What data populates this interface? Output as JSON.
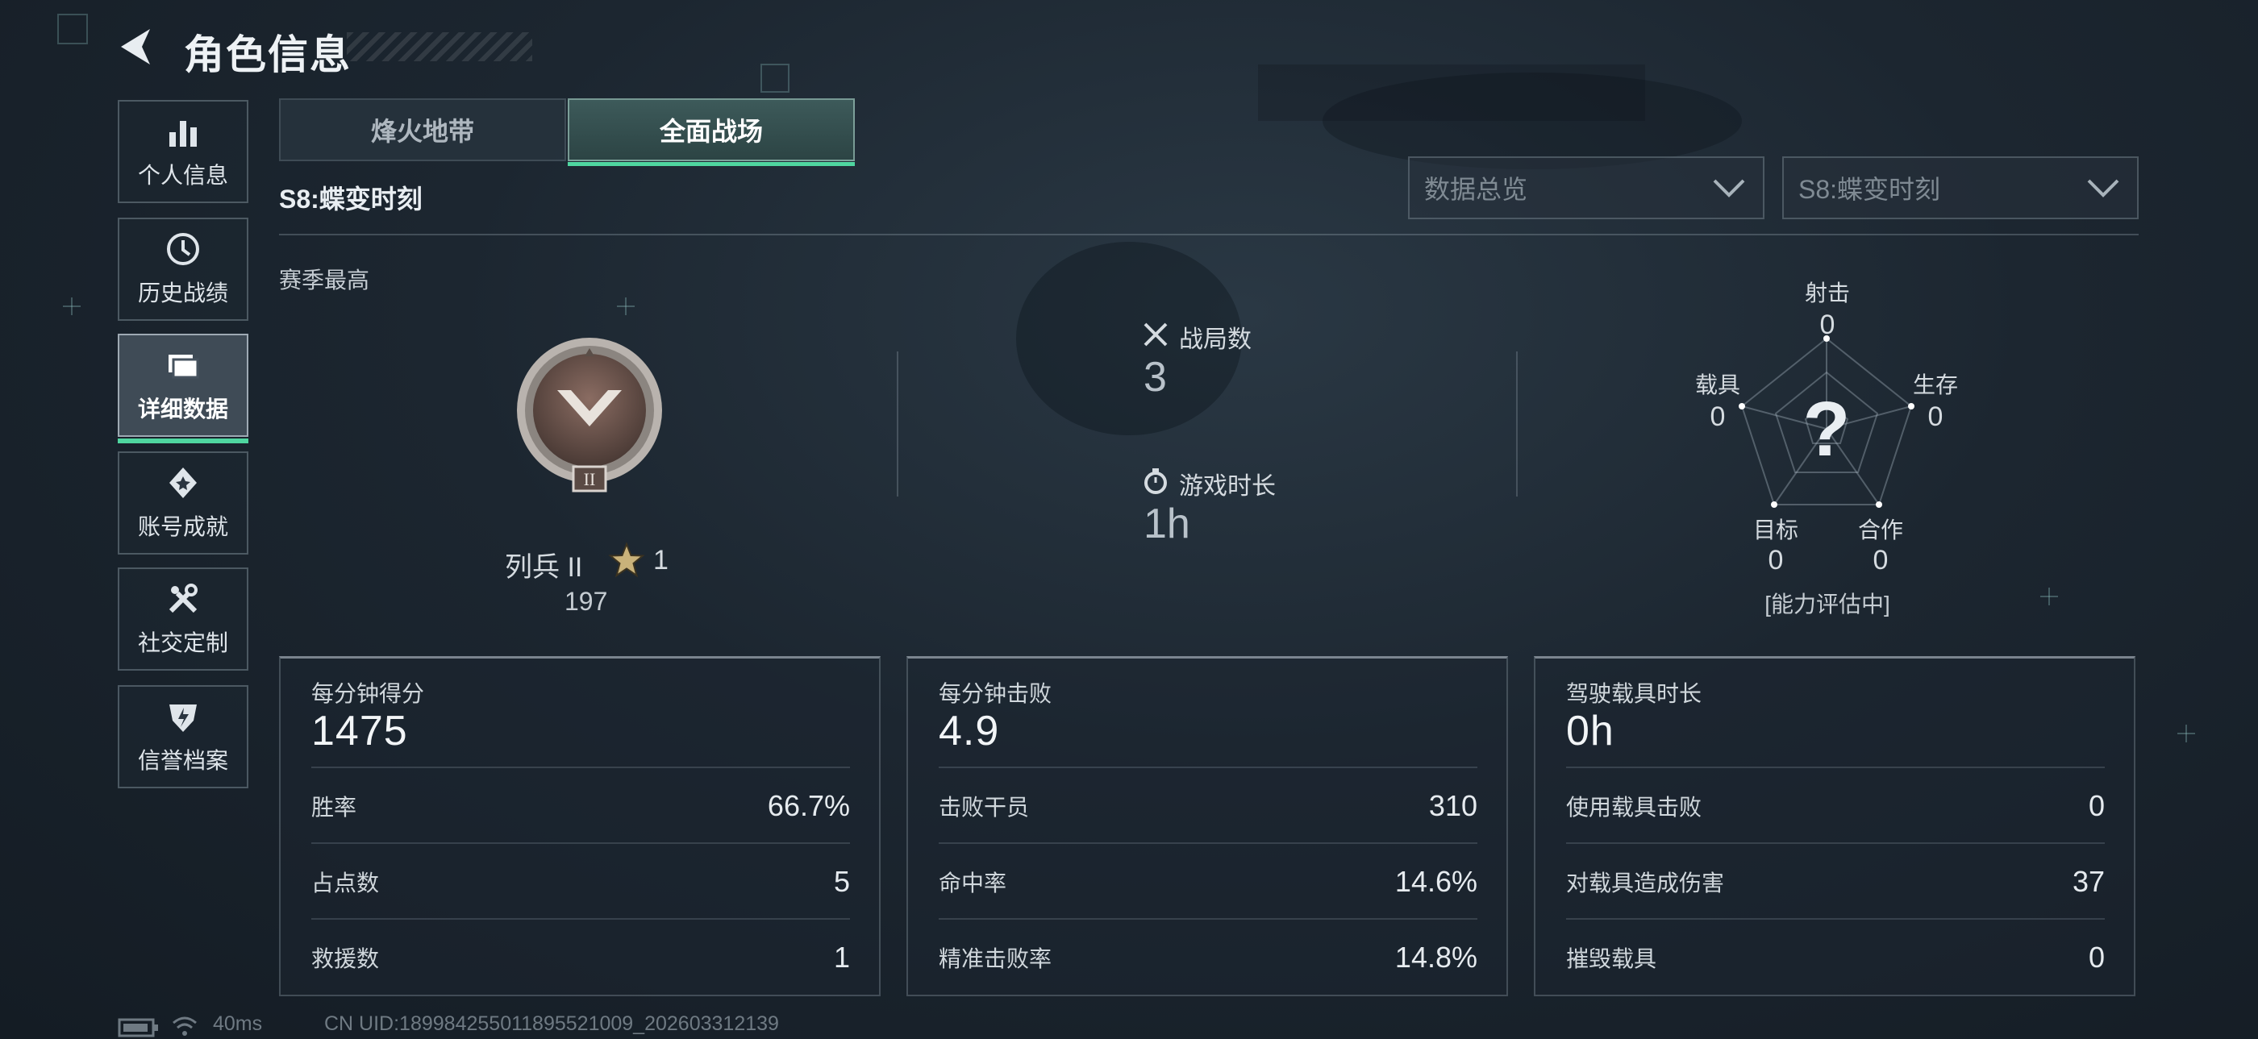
{
  "header": {
    "title": "角色信息"
  },
  "sidebar": {
    "items": [
      {
        "label": "个人信息",
        "icon": "bar-chart-icon"
      },
      {
        "label": "历史战绩",
        "icon": "history-icon"
      },
      {
        "label": "详细数据",
        "icon": "folder-icon",
        "active": true
      },
      {
        "label": "账号成就",
        "icon": "medal-icon"
      },
      {
        "label": "社交定制",
        "icon": "tools-icon"
      },
      {
        "label": "信誉档案",
        "icon": "shield-icon"
      }
    ]
  },
  "tabs": [
    {
      "label": "烽火地带",
      "active": false
    },
    {
      "label": "全面战场",
      "active": true
    }
  ],
  "season": {
    "title": "S8:蝶变时刻"
  },
  "filters": {
    "category": {
      "value": "数据总览"
    },
    "season": {
      "value": "S8:蝶变时刻"
    }
  },
  "rank": {
    "section_label": "赛季最高",
    "name": "列兵 II",
    "stars": "1",
    "score": "197"
  },
  "summary": {
    "matches": {
      "label": "战局数",
      "value": "3",
      "icon": "crossed-swords-icon"
    },
    "playtime": {
      "label": "游戏时长",
      "value": "1h",
      "icon": "stopwatch-icon"
    }
  },
  "radar": {
    "center_mark": "?",
    "axes": [
      {
        "label": "射击",
        "value": "0"
      },
      {
        "label": "生存",
        "value": "0"
      },
      {
        "label": "合作",
        "value": "0"
      },
      {
        "label": "目标",
        "value": "0"
      },
      {
        "label": "载具",
        "value": "0"
      }
    ],
    "status": "[能力评估中]"
  },
  "cards": [
    {
      "label": "每分钟得分",
      "value": "1475",
      "rows": [
        {
          "label": "胜率",
          "value": "66.7%"
        },
        {
          "label": "占点数",
          "value": "5"
        },
        {
          "label": "救援数",
          "value": "1"
        }
      ]
    },
    {
      "label": "每分钟击败",
      "value": "4.9",
      "rows": [
        {
          "label": "击败干员",
          "value": "310"
        },
        {
          "label": "命中率",
          "value": "14.6%"
        },
        {
          "label": "精准击败率",
          "value": "14.8%"
        }
      ]
    },
    {
      "label": "驾驶载具时长",
      "value": "0h",
      "rows": [
        {
          "label": "使用载具击败",
          "value": "0"
        },
        {
          "label": "对载具造成伤害",
          "value": "37"
        },
        {
          "label": "摧毁载具",
          "value": "0"
        }
      ]
    }
  ],
  "footer": {
    "ping": "40ms",
    "uid": "CN UID:189984255011895521009_202603312139"
  },
  "colors": {
    "accent": "#4fd6a0",
    "background": "#1c2630"
  }
}
